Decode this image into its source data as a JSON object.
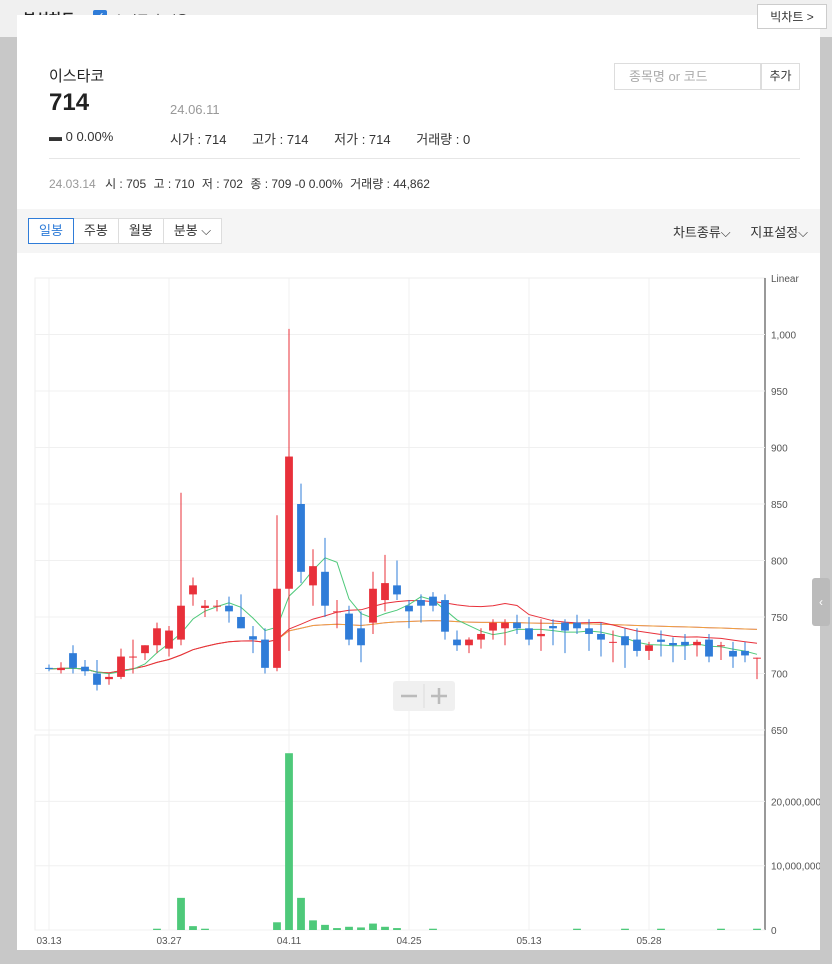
{
  "header": {
    "title": "분석차트",
    "adjust_label": "수정주가 적용",
    "big_chart": "빅차트 >"
  },
  "stock": {
    "name": "이스타코",
    "price": "714",
    "date": "24.06.11",
    "change": "▬ 0 0.00%",
    "open": "시가 : 714",
    "high": "고가 : 714",
    "low": "저가 : 714",
    "volume": "거래량 : 0"
  },
  "search": {
    "placeholder": "종목명 or 코드",
    "add": "추가"
  },
  "history": {
    "date": "24.03.14",
    "open": "시 : 705",
    "high": "고 : 710",
    "low": "저 : 702",
    "close": "종 : 709 -0 0.00%",
    "volume": "거래량 : 44,862"
  },
  "tabs": [
    "일봉",
    "주봉",
    "월봉",
    "분봉 ⌵"
  ],
  "right_links": [
    "차트종류⌵",
    "지표설정⌵"
  ],
  "chart_data": {
    "type": "candlestick",
    "scale": "Linear",
    "price_ticks": [
      1000,
      950,
      900,
      850,
      800,
      750,
      700,
      650
    ],
    "volume_ticks": [
      "20,000,000",
      "10,000,000",
      "0"
    ],
    "x_labels": [
      "03.13",
      "03.27",
      "04.11",
      "04.25",
      "05.13",
      "05.28"
    ],
    "x_label_idx": [
      0,
      10,
      20,
      30,
      40,
      50
    ],
    "ylim": [
      650,
      1050
    ],
    "vol_max": 28000000,
    "colors": {
      "up": "#e8303a",
      "down": "#2f7cd8",
      "volume": "#4ec97a",
      "ma5": "#4ec97a",
      "ma20": "#e8303a",
      "ma60": "#f2a039",
      "ma120": "#b06ce8"
    },
    "candles": [
      [
        705,
        708,
        702,
        704
      ],
      [
        703,
        710,
        700,
        705
      ],
      [
        718,
        725,
        700,
        705
      ],
      [
        706,
        712,
        698,
        702
      ],
      [
        700,
        712,
        685,
        690
      ],
      [
        695,
        700,
        690,
        697
      ],
      [
        697,
        722,
        695,
        715
      ],
      [
        715,
        730,
        700,
        715
      ],
      [
        718,
        725,
        712,
        725
      ],
      [
        725,
        745,
        718,
        740
      ],
      [
        722,
        742,
        715,
        738
      ],
      [
        730,
        860,
        725,
        760
      ],
      [
        770,
        785,
        760,
        778
      ],
      [
        758,
        765,
        750,
        760
      ],
      [
        760,
        765,
        755,
        760
      ],
      [
        760,
        768,
        745,
        755
      ],
      [
        750,
        770,
        740,
        740
      ],
      [
        733,
        742,
        718,
        730
      ],
      [
        730,
        740,
        700,
        705
      ],
      [
        705,
        840,
        702,
        775
      ],
      [
        775,
        1005,
        720,
        892
      ],
      [
        850,
        868,
        780,
        790
      ],
      [
        778,
        810,
        760,
        795
      ],
      [
        790,
        820,
        750,
        760
      ],
      [
        755,
        765,
        740,
        755
      ],
      [
        753,
        760,
        725,
        730
      ],
      [
        740,
        755,
        710,
        725
      ],
      [
        745,
        790,
        735,
        775
      ],
      [
        765,
        805,
        755,
        780
      ],
      [
        778,
        800,
        765,
        770
      ],
      [
        760,
        765,
        740,
        755
      ],
      [
        765,
        770,
        745,
        760
      ],
      [
        768,
        772,
        755,
        760
      ],
      [
        765,
        770,
        730,
        737
      ],
      [
        730,
        738,
        720,
        725
      ],
      [
        725,
        732,
        718,
        730
      ],
      [
        730,
        740,
        722,
        735
      ],
      [
        738,
        748,
        730,
        745
      ],
      [
        740,
        748,
        725,
        745
      ],
      [
        745,
        752,
        735,
        740
      ],
      [
        740,
        750,
        725,
        730
      ],
      [
        733,
        748,
        720,
        735
      ],
      [
        742,
        748,
        725,
        740
      ],
      [
        745,
        748,
        718,
        738
      ],
      [
        745,
        752,
        735,
        740
      ],
      [
        740,
        748,
        720,
        735
      ],
      [
        735,
        745,
        715,
        730
      ],
      [
        728,
        738,
        710,
        728
      ],
      [
        733,
        740,
        705,
        725
      ],
      [
        730,
        740,
        715,
        720
      ],
      [
        720,
        728,
        712,
        725
      ],
      [
        730,
        738,
        715,
        728
      ],
      [
        727,
        732,
        710,
        725
      ],
      [
        728,
        735,
        712,
        725
      ],
      [
        725,
        730,
        715,
        728
      ],
      [
        730,
        735,
        710,
        715
      ],
      [
        725,
        728,
        712,
        725
      ],
      [
        720,
        728,
        705,
        715
      ],
      [
        720,
        728,
        710,
        716
      ],
      [
        714,
        714,
        695,
        714
      ]
    ],
    "volumes": [
      0,
      0,
      0,
      0,
      0,
      0,
      0,
      0,
      0,
      200000,
      0,
      5000000,
      600000,
      200000,
      0,
      0,
      0,
      0,
      0,
      1200000,
      27500000,
      5000000,
      1500000,
      800000,
      300000,
      500000,
      400000,
      1000000,
      500000,
      300000,
      0,
      0,
      200000,
      0,
      0,
      0,
      0,
      0,
      0,
      0,
      0,
      0,
      0,
      0,
      200000,
      0,
      0,
      0,
      200000,
      0,
      0,
      200000,
      0,
      0,
      0,
      0,
      200000,
      0,
      0,
      200000
    ]
  }
}
